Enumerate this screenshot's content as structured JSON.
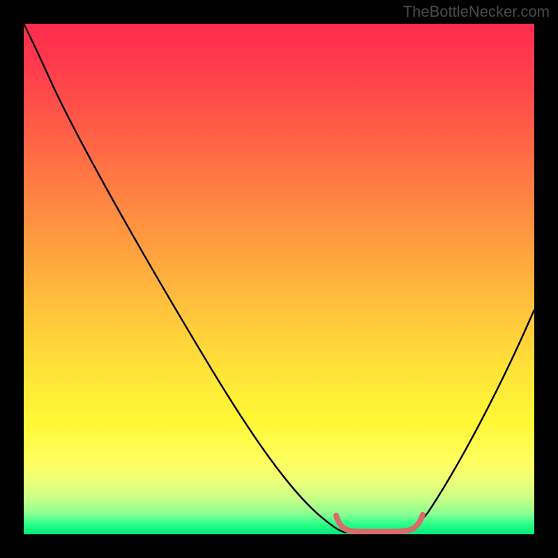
{
  "watermark": "TheBottleNecker.com",
  "chart_data": {
    "type": "line",
    "title": "",
    "xlabel": "",
    "ylabel": "",
    "xlim": [
      0,
      100
    ],
    "ylim": [
      0,
      100
    ],
    "series": [
      {
        "name": "bottleneck-curve",
        "x": [
          0,
          4,
          10,
          20,
          30,
          40,
          50,
          57,
          61,
          64,
          70,
          74,
          78,
          85,
          92,
          100
        ],
        "y": [
          100,
          95,
          87,
          73,
          59,
          44,
          30,
          20,
          9,
          2,
          0,
          0,
          2,
          13,
          27,
          44
        ],
        "color": "#000000"
      },
      {
        "name": "optimal-range-marker",
        "x": [
          61,
          62,
          64,
          70,
          74,
          76,
          78
        ],
        "y": [
          4,
          1.5,
          0.5,
          0.3,
          0.5,
          1.5,
          4
        ],
        "color": "#d96b6b"
      }
    ],
    "gradient_stops": [
      {
        "pos": 0,
        "color": "#ff2b4e"
      },
      {
        "pos": 50,
        "color": "#ffc13c"
      },
      {
        "pos": 80,
        "color": "#ffff62"
      },
      {
        "pos": 100,
        "color": "#00e878"
      }
    ]
  }
}
